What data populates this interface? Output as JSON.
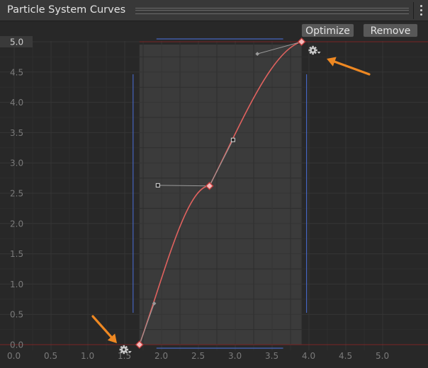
{
  "window": {
    "title": "Particle System Curves"
  },
  "toolbar": {
    "optimize_label": "Optimize",
    "remove_label": "Remove"
  },
  "icons": {
    "menu": "more-vertical-icon",
    "gear": "gear-icon",
    "arrow": "annotation-arrow-icon"
  },
  "colors": {
    "curve": "#e0625f",
    "range_lines": "#4565c0",
    "annotation": "#ee8822",
    "zero_line": "#7a2525"
  },
  "chart_data": {
    "type": "line",
    "title": "",
    "xlabel": "",
    "ylabel": "",
    "xlim": [
      0.0,
      5.0
    ],
    "ylim": [
      0.0,
      5.0
    ],
    "grid": true,
    "x_ticks": [
      "0.0",
      "0.5",
      "1.0",
      "1.5",
      "2.0",
      "2.5",
      "3.0",
      "3.5",
      "4.0",
      "4.5",
      "5.0"
    ],
    "y_ticks": [
      "0.0",
      "0.5",
      "1.0",
      "1.5",
      "2.0",
      "2.5",
      "3.0",
      "3.5",
      "4.0",
      "4.5",
      "5.0"
    ],
    "keys": [
      {
        "x": 1.7,
        "y": 0.0,
        "in_handle": null,
        "out_handle": [
          1.9,
          0.68
        ]
      },
      {
        "x": 2.65,
        "y": 2.62,
        "in_handle": [
          1.95,
          2.63
        ],
        "out_handle": [
          2.97,
          3.38
        ]
      },
      {
        "x": 3.9,
        "y": 5.0,
        "in_handle": [
          3.3,
          4.8
        ],
        "out_handle": null
      }
    ],
    "selection_range": {
      "x": [
        1.7,
        3.9
      ],
      "y": [
        0.0,
        5.0
      ]
    }
  }
}
